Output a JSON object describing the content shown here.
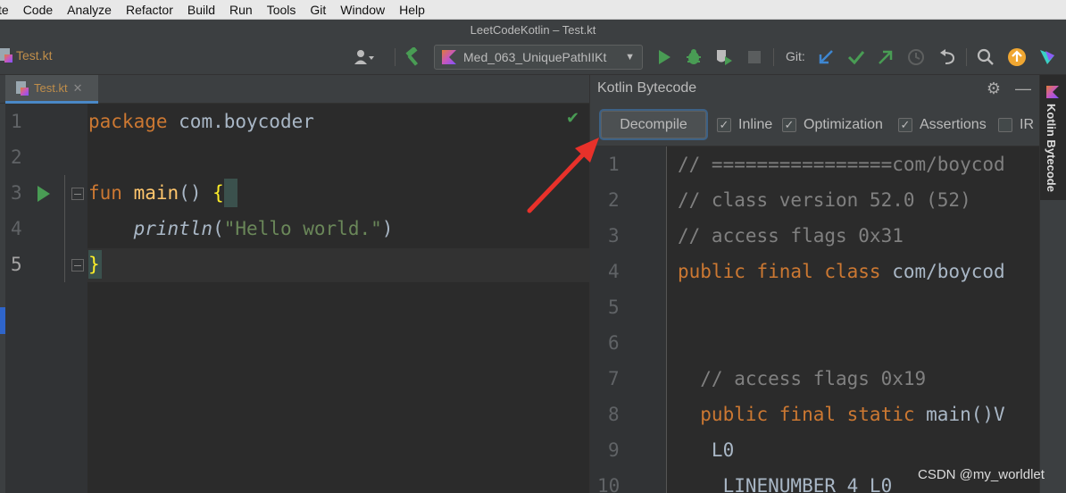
{
  "menubar": {
    "items": [
      "te",
      "Code",
      "Analyze",
      "Refactor",
      "Build",
      "Run",
      "Tools",
      "Git",
      "Window",
      "Help"
    ]
  },
  "window": {
    "title": "LeetCodeKotlin – Test.kt"
  },
  "toolbar": {
    "breadcrumb_file": "Test.kt",
    "run_config": "Med_063_UniquePathIIKt",
    "git_label": "Git:"
  },
  "editor": {
    "tab_label": "Test.kt",
    "line_numbers": [
      "1",
      "2",
      "3",
      "4",
      "5"
    ],
    "lines": {
      "l1_kw": "package",
      "l1_rest": " com.boycoder",
      "l3_kw": "fun",
      "l3_fn": "main",
      "l3_parens": "() ",
      "l3_brace": "{",
      "l4_indent": "    ",
      "l4_call": "println",
      "l4_open": "(",
      "l4_str": "\"Hello world.\"",
      "l4_close": ")",
      "l5_brace": "}"
    }
  },
  "bytecode_panel": {
    "title": "Kotlin Bytecode",
    "decompile_label": "Decompile",
    "options": [
      {
        "label": "Inline",
        "checked": true
      },
      {
        "label": "Optimization",
        "checked": true
      },
      {
        "label": "Assertions",
        "checked": true
      },
      {
        "label": "IR",
        "checked": false
      }
    ],
    "line_numbers": [
      "1",
      "2",
      "3",
      "4",
      "5",
      "6",
      "7",
      "8",
      "9",
      "10"
    ],
    "lines": {
      "b1": "// ================com/boycod",
      "b2": "// class version 52.0 (52)",
      "b3": "// access flags 0x31",
      "b4_kw": "public final class",
      "b4_rest": " com/boycod",
      "b7": "  // access flags 0x19",
      "b8_kw": "  public final static",
      "b8_rest": " main()V",
      "b9": "   L0",
      "b10": "    LINENUMBER 4 L0"
    }
  },
  "right_stripe": {
    "tab_label": "Kotlin Bytecode"
  },
  "watermark": "CSDN @my_worldlet",
  "colors": {
    "background": "#2b2b2b",
    "keyword": "#cc7832",
    "string": "#6a8759",
    "function": "#ffc66d",
    "annotation_arrow": "#e8312a"
  }
}
